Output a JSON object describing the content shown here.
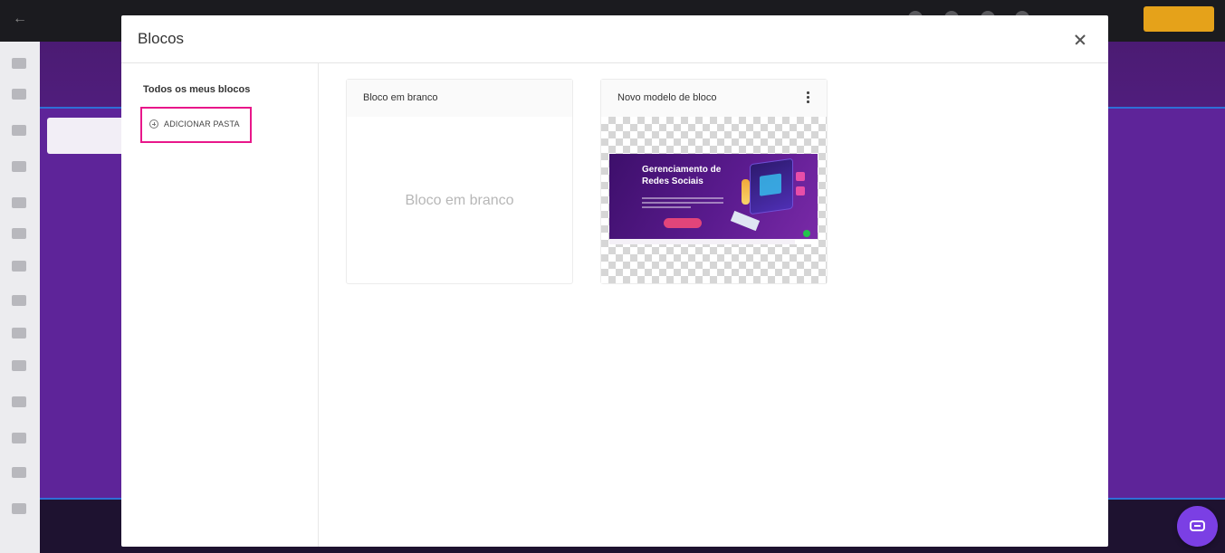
{
  "background": {
    "brand_color": "#6d2b8e",
    "publish_color": "#e5a21a"
  },
  "modal": {
    "title": "Blocos",
    "close_icon": "close-icon",
    "folders": {
      "heading": "Todos os meus blocos",
      "add_folder_label": "ADICIONAR PASTA",
      "add_folder_icon": "plus-circle-icon",
      "highlight_color": "#e8178a"
    },
    "blocks": [
      {
        "title": "Bloco em branco",
        "placeholder_text": "Bloco em branco",
        "type": "blank"
      },
      {
        "title": "Novo modelo de bloco",
        "type": "template",
        "menu_icon": "kebab-menu-icon",
        "preview": {
          "heading": "Gerenciamento de Redes Sociais",
          "accent_color": "#e2457a"
        }
      }
    ]
  },
  "chat_widget": {
    "icon": "chat-icon",
    "color": "#7b3fe4"
  }
}
